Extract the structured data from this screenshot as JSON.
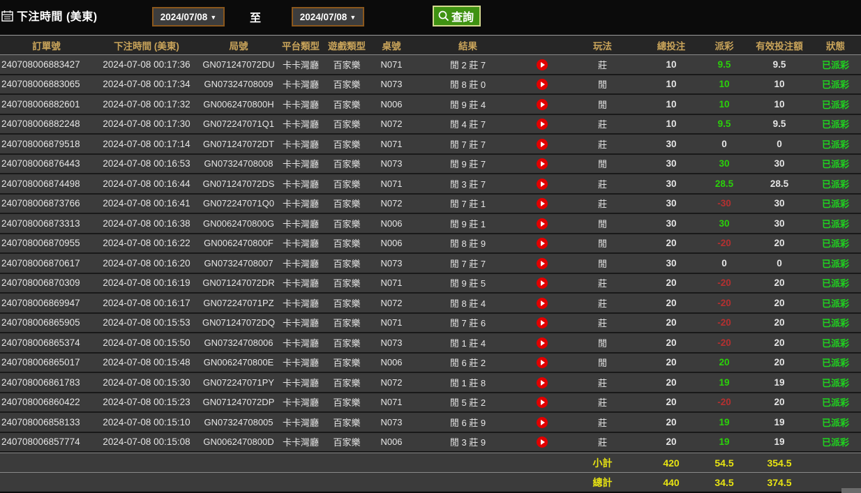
{
  "toolbar": {
    "title": "下注時間 (美東)",
    "date_from": "2024/07/08",
    "date_to": "2024/07/08",
    "to_label": "至",
    "search_label": "查詢",
    "caret": "▼"
  },
  "table": {
    "columns": [
      "訂單號",
      "下注時間 (美東)",
      "局號",
      "平台類型",
      "遊戲類型",
      "桌號",
      "結果",
      "",
      "玩法",
      "總投注",
      "派彩",
      "有效投注額",
      "狀態"
    ],
    "rows": [
      {
        "order": "240708006883427",
        "time": "2024-07-08 00:17:36",
        "round": "GN071247072DU",
        "platform": "卡卡灣廳",
        "game": "百家樂",
        "table_no": "N071",
        "result": "閒 2 莊 7",
        "method": "莊",
        "total_bet": "10",
        "payout": "9.5",
        "payout_state": "win",
        "valid_bet": "9.5",
        "status": "已派彩"
      },
      {
        "order": "240708006883065",
        "time": "2024-07-08 00:17:34",
        "round": "GN07324708009",
        "platform": "卡卡灣廳",
        "game": "百家樂",
        "table_no": "N073",
        "result": "閒 8 莊 0",
        "method": "閒",
        "total_bet": "10",
        "payout": "10",
        "payout_state": "win",
        "valid_bet": "10",
        "status": "已派彩"
      },
      {
        "order": "240708006882601",
        "time": "2024-07-08 00:17:32",
        "round": "GN0062470800H",
        "platform": "卡卡灣廳",
        "game": "百家樂",
        "table_no": "N006",
        "result": "閒 9 莊 4",
        "method": "閒",
        "total_bet": "10",
        "payout": "10",
        "payout_state": "win",
        "valid_bet": "10",
        "status": "已派彩"
      },
      {
        "order": "240708006882248",
        "time": "2024-07-08 00:17:30",
        "round": "GN072247071Q1",
        "platform": "卡卡灣廳",
        "game": "百家樂",
        "table_no": "N072",
        "result": "閒 4 莊 7",
        "method": "莊",
        "total_bet": "10",
        "payout": "9.5",
        "payout_state": "win",
        "valid_bet": "9.5",
        "status": "已派彩"
      },
      {
        "order": "240708006879518",
        "time": "2024-07-08 00:17:14",
        "round": "GN071247072DT",
        "platform": "卡卡灣廳",
        "game": "百家樂",
        "table_no": "N071",
        "result": "閒 7 莊 7",
        "method": "莊",
        "total_bet": "30",
        "payout": "0",
        "payout_state": "zero",
        "valid_bet": "0",
        "status": "已派彩"
      },
      {
        "order": "240708006876443",
        "time": "2024-07-08 00:16:53",
        "round": "GN07324708008",
        "platform": "卡卡灣廳",
        "game": "百家樂",
        "table_no": "N073",
        "result": "閒 9 莊 7",
        "method": "閒",
        "total_bet": "30",
        "payout": "30",
        "payout_state": "win",
        "valid_bet": "30",
        "status": "已派彩"
      },
      {
        "order": "240708006874498",
        "time": "2024-07-08 00:16:44",
        "round": "GN071247072DS",
        "platform": "卡卡灣廳",
        "game": "百家樂",
        "table_no": "N071",
        "result": "閒 3 莊 7",
        "method": "莊",
        "total_bet": "30",
        "payout": "28.5",
        "payout_state": "win",
        "valid_bet": "28.5",
        "status": "已派彩"
      },
      {
        "order": "240708006873766",
        "time": "2024-07-08 00:16:41",
        "round": "GN072247071Q0",
        "platform": "卡卡灣廳",
        "game": "百家樂",
        "table_no": "N072",
        "result": "閒 7 莊 1",
        "method": "莊",
        "total_bet": "30",
        "payout": "-30",
        "payout_state": "loss",
        "valid_bet": "30",
        "status": "已派彩"
      },
      {
        "order": "240708006873313",
        "time": "2024-07-08 00:16:38",
        "round": "GN0062470800G",
        "platform": "卡卡灣廳",
        "game": "百家樂",
        "table_no": "N006",
        "result": "閒 9 莊 1",
        "method": "閒",
        "total_bet": "30",
        "payout": "30",
        "payout_state": "win",
        "valid_bet": "30",
        "status": "已派彩"
      },
      {
        "order": "240708006870955",
        "time": "2024-07-08 00:16:22",
        "round": "GN0062470800F",
        "platform": "卡卡灣廳",
        "game": "百家樂",
        "table_no": "N006",
        "result": "閒 8 莊 9",
        "method": "閒",
        "total_bet": "20",
        "payout": "-20",
        "payout_state": "loss",
        "valid_bet": "20",
        "status": "已派彩"
      },
      {
        "order": "240708006870617",
        "time": "2024-07-08 00:16:20",
        "round": "GN07324708007",
        "platform": "卡卡灣廳",
        "game": "百家樂",
        "table_no": "N073",
        "result": "閒 7 莊 7",
        "method": "閒",
        "total_bet": "30",
        "payout": "0",
        "payout_state": "zero",
        "valid_bet": "0",
        "status": "已派彩"
      },
      {
        "order": "240708006870309",
        "time": "2024-07-08 00:16:19",
        "round": "GN071247072DR",
        "platform": "卡卡灣廳",
        "game": "百家樂",
        "table_no": "N071",
        "result": "閒 9 莊 5",
        "method": "莊",
        "total_bet": "20",
        "payout": "-20",
        "payout_state": "loss",
        "valid_bet": "20",
        "status": "已派彩"
      },
      {
        "order": "240708006869947",
        "time": "2024-07-08 00:16:17",
        "round": "GN072247071PZ",
        "platform": "卡卡灣廳",
        "game": "百家樂",
        "table_no": "N072",
        "result": "閒 8 莊 4",
        "method": "莊",
        "total_bet": "20",
        "payout": "-20",
        "payout_state": "loss",
        "valid_bet": "20",
        "status": "已派彩"
      },
      {
        "order": "240708006865905",
        "time": "2024-07-08 00:15:53",
        "round": "GN071247072DQ",
        "platform": "卡卡灣廳",
        "game": "百家樂",
        "table_no": "N071",
        "result": "閒 7 莊 6",
        "method": "莊",
        "total_bet": "20",
        "payout": "-20",
        "payout_state": "loss",
        "valid_bet": "20",
        "status": "已派彩"
      },
      {
        "order": "240708006865374",
        "time": "2024-07-08 00:15:50",
        "round": "GN07324708006",
        "platform": "卡卡灣廳",
        "game": "百家樂",
        "table_no": "N073",
        "result": "閒 1 莊 4",
        "method": "閒",
        "total_bet": "20",
        "payout": "-20",
        "payout_state": "loss",
        "valid_bet": "20",
        "status": "已派彩"
      },
      {
        "order": "240708006865017",
        "time": "2024-07-08 00:15:48",
        "round": "GN0062470800E",
        "platform": "卡卡灣廳",
        "game": "百家樂",
        "table_no": "N006",
        "result": "閒 6 莊 2",
        "method": "閒",
        "total_bet": "20",
        "payout": "20",
        "payout_state": "win",
        "valid_bet": "20",
        "status": "已派彩"
      },
      {
        "order": "240708006861783",
        "time": "2024-07-08 00:15:30",
        "round": "GN072247071PY",
        "platform": "卡卡灣廳",
        "game": "百家樂",
        "table_no": "N072",
        "result": "閒 1 莊 8",
        "method": "莊",
        "total_bet": "20",
        "payout": "19",
        "payout_state": "win",
        "valid_bet": "19",
        "status": "已派彩"
      },
      {
        "order": "240708006860422",
        "time": "2024-07-08 00:15:23",
        "round": "GN071247072DP",
        "platform": "卡卡灣廳",
        "game": "百家樂",
        "table_no": "N071",
        "result": "閒 5 莊 2",
        "method": "莊",
        "total_bet": "20",
        "payout": "-20",
        "payout_state": "loss",
        "valid_bet": "20",
        "status": "已派彩"
      },
      {
        "order": "240708006858133",
        "time": "2024-07-08 00:15:10",
        "round": "GN07324708005",
        "platform": "卡卡灣廳",
        "game": "百家樂",
        "table_no": "N073",
        "result": "閒 6 莊 9",
        "method": "莊",
        "total_bet": "20",
        "payout": "19",
        "payout_state": "win",
        "valid_bet": "19",
        "status": "已派彩"
      },
      {
        "order": "240708006857774",
        "time": "2024-07-08 00:15:08",
        "round": "GN0062470800D",
        "platform": "卡卡灣廳",
        "game": "百家樂",
        "table_no": "N006",
        "result": "閒 3 莊 9",
        "method": "莊",
        "total_bet": "20",
        "payout": "19",
        "payout_state": "win",
        "valid_bet": "19",
        "status": "已派彩"
      }
    ],
    "footer": [
      {
        "label": "小計",
        "total_bet": "420",
        "payout": "54.5",
        "valid_bet": "354.5"
      },
      {
        "label": "總計",
        "total_bet": "440",
        "payout": "34.5",
        "valid_bet": "374.5"
      }
    ]
  },
  "colors": {
    "header_gold": "#c9a45a",
    "positive_green": "#2bd10a",
    "negative_red": "#b53030",
    "status_green": "#1fd41f",
    "footer_yellow": "#e8e412",
    "button_green": "#3f9212",
    "button_border": "#d3d98f",
    "datepicker_border": "#8a571c",
    "row_bg": "#3b3b3b",
    "play_red": "#e10000"
  }
}
